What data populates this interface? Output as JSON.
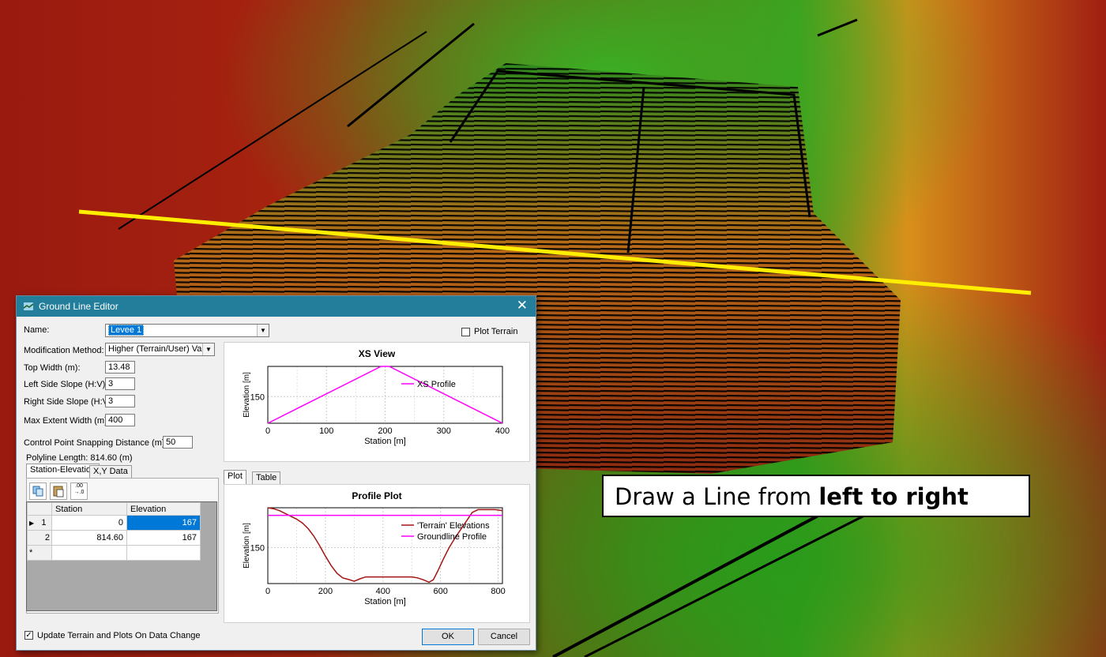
{
  "background": {
    "description_colors": {
      "red": "#b02010",
      "green": "#3aa020",
      "yellow": "#e8d800"
    }
  },
  "annotation": {
    "prefix": "Draw a Line from ",
    "bold": "left to right"
  },
  "dialog": {
    "title": "Ground Line Editor",
    "close": "✕",
    "name_label": "Name:",
    "name_value": "Levee 1",
    "plot_terrain_label": "Plot Terrain",
    "modification_method_label": "Modification Method:",
    "modification_method_value": "Higher (Terrain/User) Value",
    "top_width_label": "Top Width (m):",
    "top_width_value": "13.48",
    "left_slope_label": "Left Side Slope (H:V):",
    "left_slope_value": "3",
    "right_slope_label": "Right Side Slope (H:V):",
    "right_slope_value": "3",
    "max_extent_label": "Max Extent Width (m):",
    "max_extent_value": "400",
    "snapping_label": "Control Point Snapping Distance (m):",
    "snapping_value": "50",
    "polyline_length": "Polyline Length: 814.60 (m)",
    "tabs": [
      "Station-Elevation",
      "X,Y Data"
    ],
    "toolbar_icons": [
      "copy-icon",
      "paste-icon",
      "decimal-icon"
    ],
    "table": {
      "headers": [
        "Station",
        "Elevation"
      ],
      "rows": [
        {
          "marker": "▶",
          "num": "1",
          "station": "0",
          "elevation": "167"
        },
        {
          "marker": "",
          "num": "2",
          "station": "814.60",
          "elevation": "167"
        },
        {
          "marker": "*",
          "num": "",
          "station": "",
          "elevation": ""
        }
      ]
    },
    "plot_tabs": [
      "Plot",
      "Table"
    ],
    "update_label": "Update Terrain and Plots On Data Change",
    "ok_label": "OK",
    "cancel_label": "Cancel"
  },
  "chart_data": [
    {
      "type": "line",
      "title": "XS View",
      "xlabel": "Station [m]",
      "ylabel": "Elevation [m]",
      "xlim": [
        0,
        400
      ],
      "ylim": [
        135,
        167
      ],
      "xticks": [
        0,
        100,
        200,
        300,
        400
      ],
      "yticks": [
        150
      ],
      "grid": true,
      "legend": "top-right",
      "series": [
        {
          "name": "XS Profile",
          "color": "#ff00ff",
          "x": [
            0,
            193,
            207,
            400
          ],
          "y": [
            135,
            167,
            167,
            135
          ]
        }
      ]
    },
    {
      "type": "line",
      "title": "Profile Plot",
      "xlabel": "Station [m]",
      "ylabel": "Elevation [m]",
      "xlim": [
        0,
        815
      ],
      "ylim": [
        131,
        171
      ],
      "xticks": [
        0,
        200,
        400,
        600,
        800
      ],
      "yticks": [
        150
      ],
      "grid": true,
      "legend": "top-right",
      "series": [
        {
          "name": "'Terrain' Elevations",
          "color": "#a31515",
          "x": [
            0,
            20,
            40,
            60,
            80,
            100,
            120,
            140,
            160,
            180,
            200,
            220,
            240,
            260,
            280,
            300,
            320,
            340,
            360,
            380,
            400,
            420,
            440,
            460,
            480,
            500,
            520,
            540,
            560,
            575,
            590,
            610,
            630,
            650,
            670,
            690,
            710,
            730,
            760,
            790,
            815
          ],
          "y": [
            171,
            170.5,
            169.5,
            168,
            166.5,
            165,
            163,
            160,
            156,
            151,
            145.5,
            140.5,
            136.5,
            134,
            133.2,
            132.2,
            133.5,
            134.5,
            134.5,
            134.5,
            134.5,
            134.5,
            134.5,
            134.5,
            134.5,
            134.5,
            134,
            133,
            131.7,
            133,
            137.5,
            144,
            150,
            155,
            159.5,
            164,
            168.5,
            170,
            170,
            170,
            169.5
          ]
        },
        {
          "name": "Groundline Profile",
          "color": "#ff00ff",
          "x": [
            0,
            815
          ],
          "y": [
            167,
            167
          ]
        }
      ]
    }
  ]
}
